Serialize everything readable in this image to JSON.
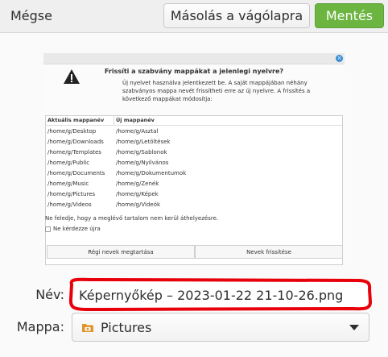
{
  "header": {
    "cancel_label": "Mégse",
    "copy_label": "Másolás a vágólapra",
    "save_label": "Mentés"
  },
  "preview": {
    "title": "Frissíti a szabvány mappákat a jelenlegi nyelvre?",
    "message": "Új nyelvet használva jelentkezett be. A saját mappájában néhány szabványos mappa nevét frissítheti erre az új nyelvre. A frissítés a következő mappákat módosítja:",
    "col_current": "Aktuális mappanév",
    "col_new": "Új mappanév",
    "rows": [
      {
        "current": "/home/g/Desktop",
        "new": "/home/g/Asztal"
      },
      {
        "current": "/home/g/Downloads",
        "new": "/home/g/Letöltések"
      },
      {
        "current": "/home/g/Templates",
        "new": "/home/g/Sablonok"
      },
      {
        "current": "/home/g/Public",
        "new": "/home/g/Nyilvános"
      },
      {
        "current": "/home/g/Documents",
        "new": "/home/g/Dokumentumok"
      },
      {
        "current": "/home/g/Music",
        "new": "/home/g/Zenék"
      },
      {
        "current": "/home/g/Pictures",
        "new": "/home/g/Képek"
      },
      {
        "current": "/home/g/Videos",
        "new": "/home/g/Videók"
      }
    ],
    "note": "Ne feledje, hogy a meglévő tartalom nem kerül áthelyezésre.",
    "dont_ask": "Ne kérdezze újra",
    "keep_button": "Régi nevek megtartása",
    "update_button": "Nevek frissítése"
  },
  "form": {
    "name_label": "Név:",
    "filename": "Képernyőkép – 2023-01-22 21-10-26.png",
    "folder_label": "Mappa:",
    "folder_value": "Pictures"
  },
  "colors": {
    "save_bg": "#6cb541",
    "highlight": "#e8000b"
  }
}
